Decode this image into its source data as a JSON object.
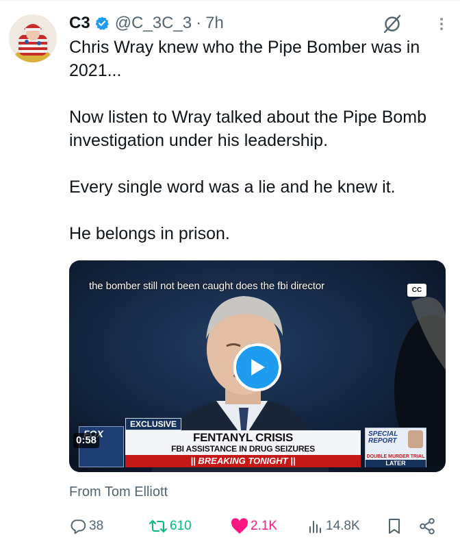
{
  "tweet": {
    "display_name": "C3",
    "handle": "@C_3C_3",
    "separator": "·",
    "time": "7h",
    "paragraphs": [
      "Chris Wray knew who the Pipe Bomber was in 2021...",
      "Now listen to Wray talked about the Pipe Bomb investigation under his leadership.",
      "Every single word was a lie and he knew it.",
      "He belongs in prison."
    ],
    "from_label": "From Tom Elliott"
  },
  "video": {
    "caption": "the bomber still not been caught does the fbi director",
    "cc_label": "CC",
    "duration": "0:58",
    "lower_third": {
      "tag": "EXCLUSIVE",
      "title": "FENTANYL CRISIS",
      "subtitle": "FBI ASSISTANCE IN DRUG SEIZURES",
      "banner": "|| BREAKING TONIGHT ||",
      "network_logo": "FOX",
      "promo_title": "SPECIAL REPORT",
      "promo_subtitle": "DOUBLE MURDER TRIAL",
      "promo_time": "LATER"
    }
  },
  "actions": {
    "replies": "38",
    "reposts": "610",
    "likes": "2.1K",
    "views": "14.8K"
  },
  "colors": {
    "accent": "#1d9bf0",
    "repost": "#00ba7c",
    "like": "#f91880",
    "muted": "#536471"
  },
  "icons": [
    "verified-badge-icon",
    "grok-icon",
    "more-icon",
    "play-icon",
    "reply-icon",
    "repost-icon",
    "like-icon",
    "views-icon",
    "bookmark-icon",
    "share-icon"
  ]
}
